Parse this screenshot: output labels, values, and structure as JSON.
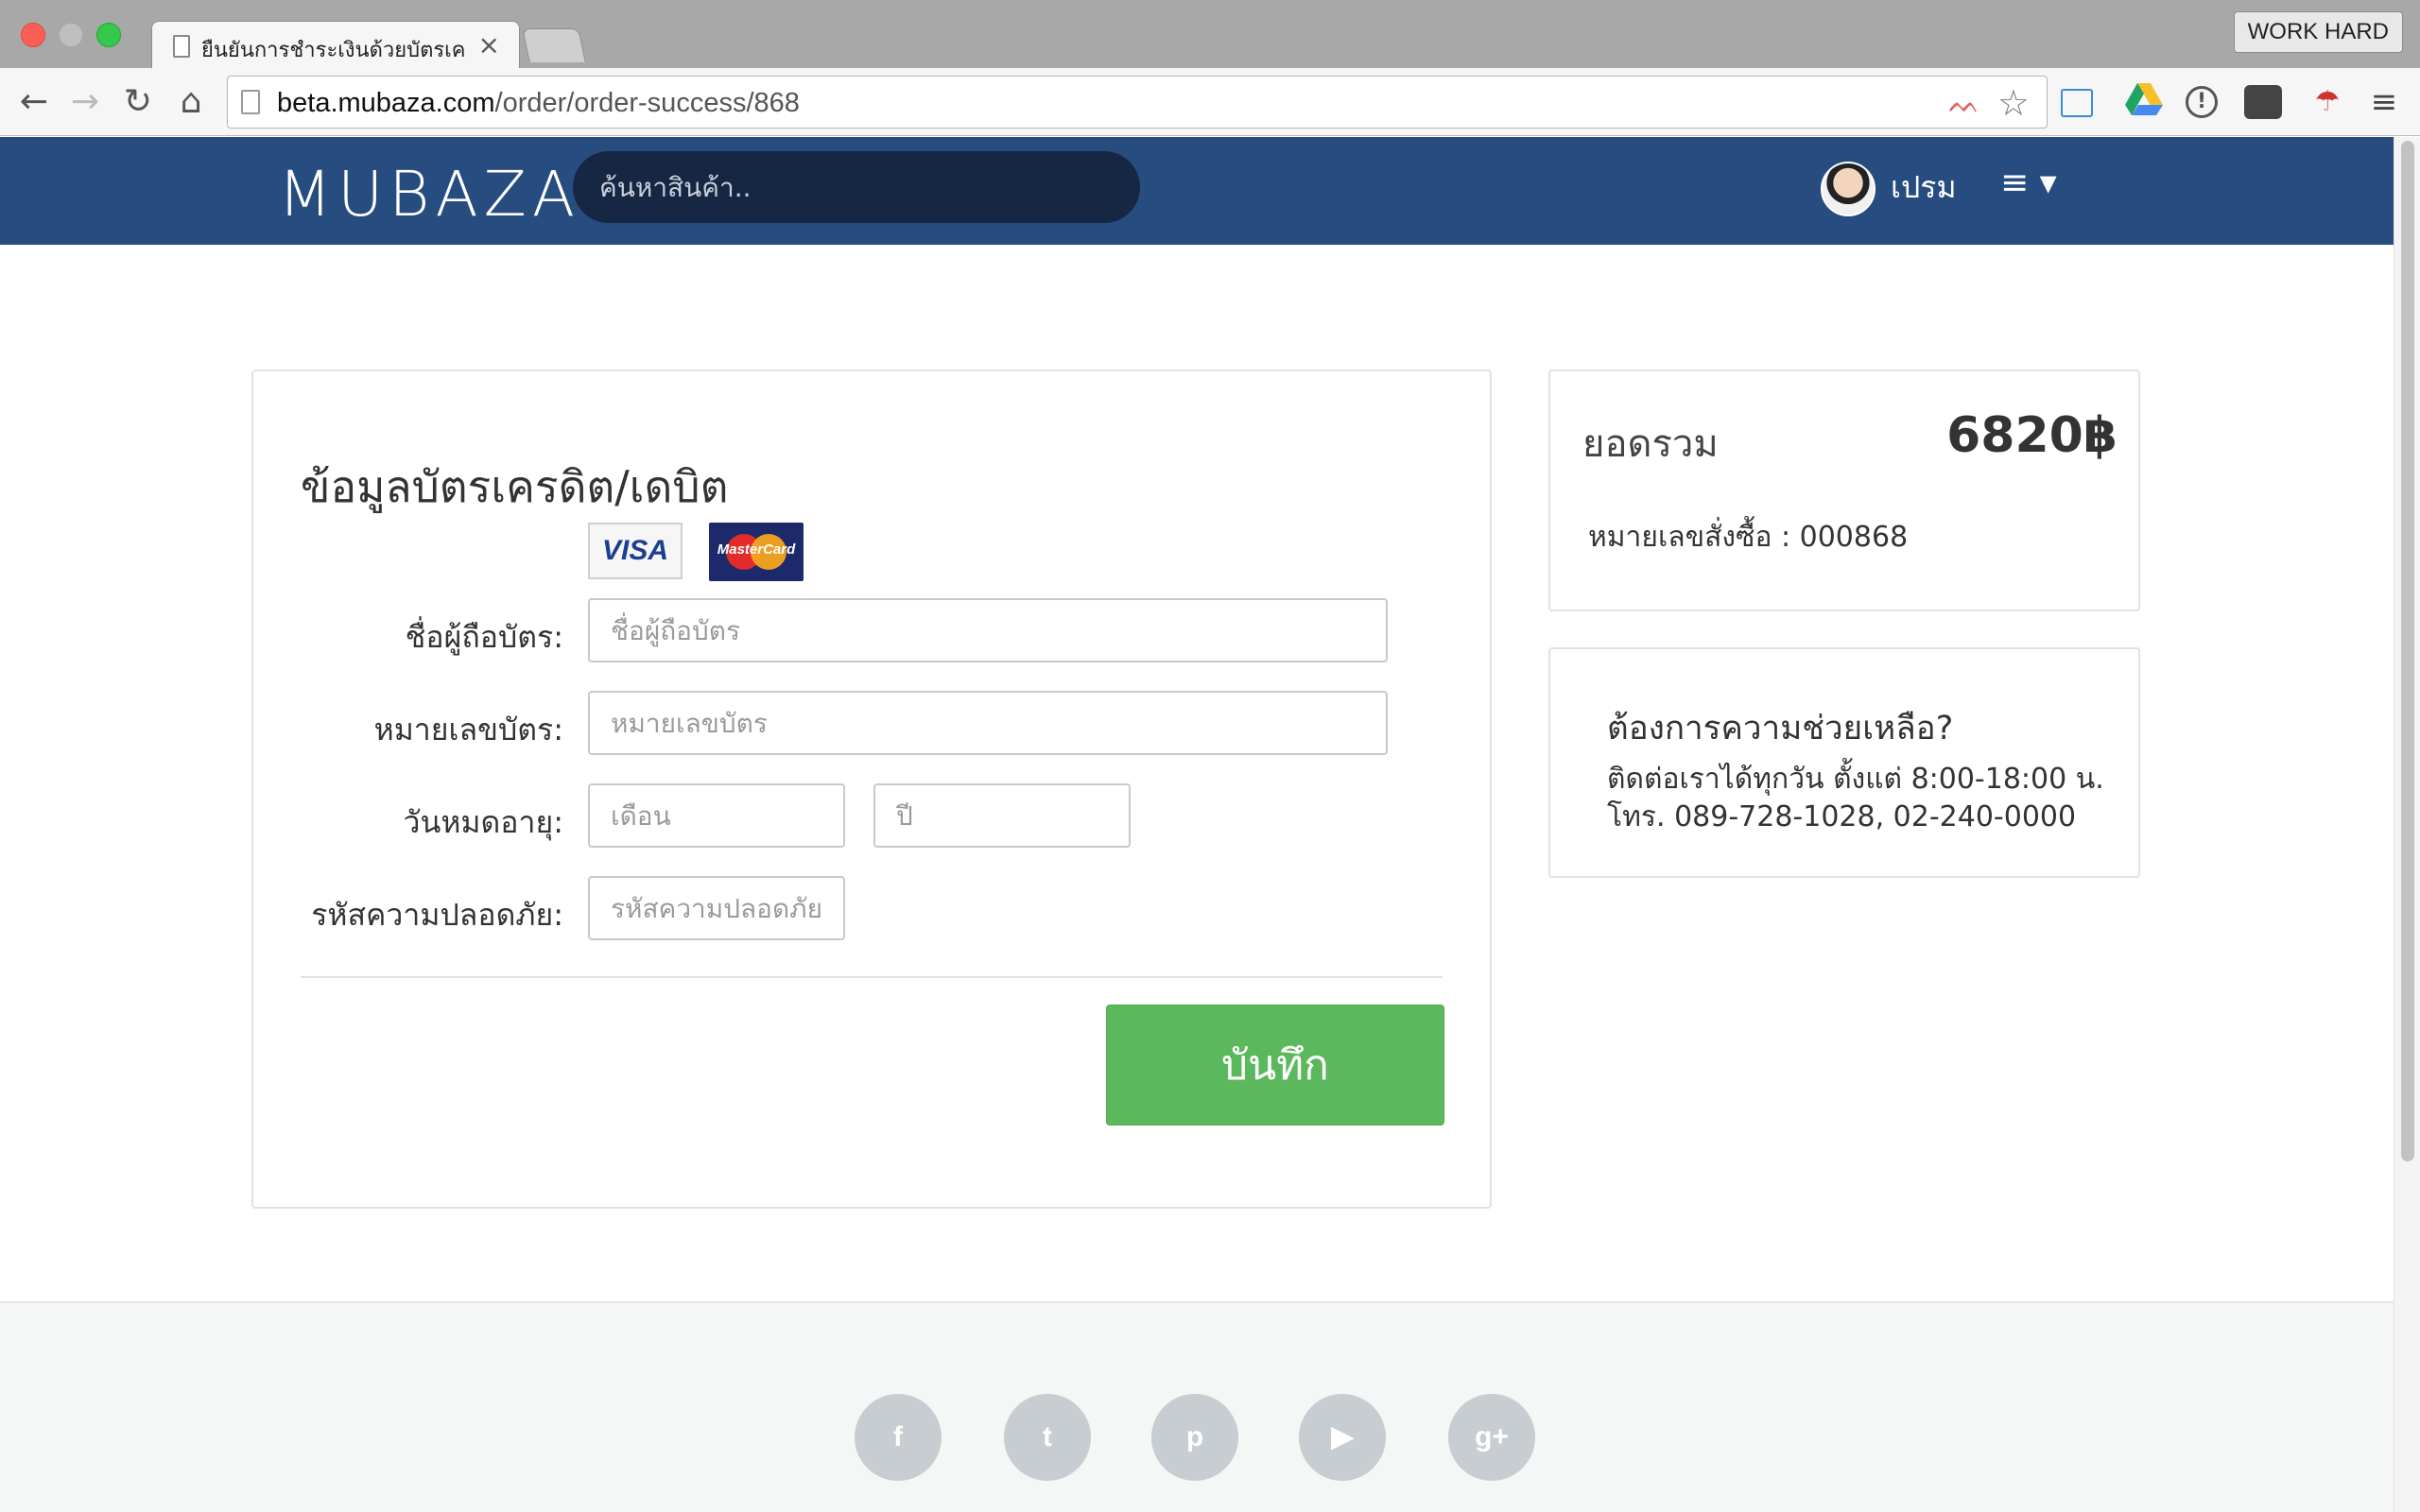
{
  "browser": {
    "tab_title": "ยืนยันการชำระเงินด้วยบัตรเครดิ",
    "tab_close": "×",
    "work_hard": "WORK HARD",
    "url_host": "beta.mubaza.com",
    "url_path": "/order/order-success/868",
    "icons": {
      "back": "←",
      "forward": "→",
      "reload": "↻",
      "home": "⌂",
      "star": "☆",
      "lastpass": "ᨓ",
      "menu": "≡"
    }
  },
  "header": {
    "logo": "MUBAZA",
    "search_placeholder": "ค้นหาสินค้า..",
    "username": "เปรม",
    "menu_icon": "≡ ▾"
  },
  "form": {
    "title": "ข้อมูลบัตรเครดิต/เดบิต",
    "visa": "VISA",
    "mastercard": "MasterCard",
    "cardholder_label": "ชื่อผู้ถือบัตร:",
    "cardholder_placeholder": "ชื่อผู้ถือบัตร",
    "cardnumber_label": "หมายเลขบัตร:",
    "cardnumber_placeholder": "หมายเลขบัตร",
    "expiry_label": "วันหมดอายุ:",
    "month_placeholder": "เดือน",
    "year_placeholder": "ปี",
    "cvv_label": "รหัสความปลอดภัย:",
    "cvv_placeholder": "รหัสความปลอดภัย",
    "save_button": "บันทึก"
  },
  "summary": {
    "total_label": "ยอดรวม",
    "total_value": "6820฿",
    "order_number": "หมายเลขสั่งซื้อ : 000868"
  },
  "help": {
    "title": "ต้องการความช่วยเหลือ?",
    "line1": "ติดต่อเราได้ทุกวัน ตั้งแต่ 8:00-18:00 น.",
    "line2": "โทร. 089-728-1028, 02-240-0000"
  },
  "footer": {
    "social": [
      {
        "name": "facebook",
        "glyph": "f"
      },
      {
        "name": "twitter",
        "glyph": "t"
      },
      {
        "name": "pinterest",
        "glyph": "p"
      },
      {
        "name": "youtube",
        "glyph": "▶"
      },
      {
        "name": "google-plus",
        "glyph": "g+"
      }
    ]
  },
  "colors": {
    "navbar": "#264c80",
    "search_bg": "#152743",
    "save_button": "#5cb85c",
    "footer_bg": "#f5f6f6",
    "social_icon": "#c7cdd1"
  }
}
